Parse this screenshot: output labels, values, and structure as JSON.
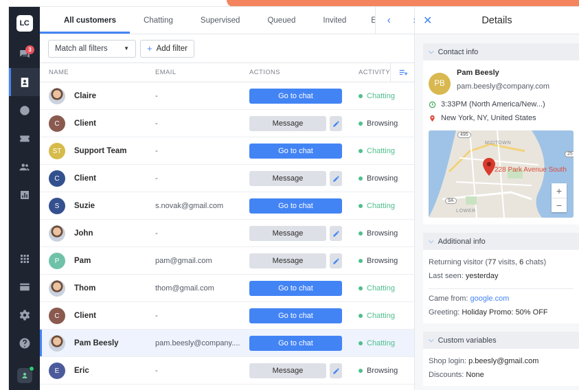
{
  "sidebar": {
    "logo_text": "LC",
    "chats_badge": "3",
    "items": [
      {
        "icon": "chat-bubbles-icon"
      },
      {
        "icon": "customers-icon"
      },
      {
        "icon": "clock-icon"
      },
      {
        "icon": "inbox-icon"
      },
      {
        "icon": "team-icon"
      },
      {
        "icon": "reports-icon"
      },
      {
        "icon": "apps-grid-icon"
      },
      {
        "icon": "billing-card-icon"
      },
      {
        "icon": "settings-gear-icon"
      },
      {
        "icon": "help-icon"
      }
    ]
  },
  "tabs": {
    "items": [
      "All customers",
      "Chatting",
      "Supervised",
      "Queued",
      "Invited"
    ],
    "overflow": "E",
    "active": "All customers"
  },
  "filters": {
    "select_label": "Match all filters",
    "add_label": "Add filter"
  },
  "table": {
    "headers": {
      "name": "NAME",
      "email": "EMAIL",
      "actions": "ACTIONS",
      "activity": "ACTIVITY"
    },
    "rows": [
      {
        "initial": "",
        "photo": true,
        "avatar_color": "",
        "name": "Claire",
        "email": "-",
        "action": "Go to chat",
        "action_type": "chat",
        "status": "Chatting"
      },
      {
        "initial": "C",
        "photo": false,
        "avatar_color": "#8a5a4f",
        "name": "Client",
        "email": "-",
        "action": "Message",
        "action_type": "msg",
        "status": "Browsing"
      },
      {
        "initial": "ST",
        "photo": false,
        "avatar_color": "#d6bb4b",
        "name": "Support Team",
        "email": "-",
        "action": "Go to chat",
        "action_type": "chat",
        "status": "Chatting"
      },
      {
        "initial": "C",
        "photo": false,
        "avatar_color": "#33508f",
        "name": "Client",
        "email": "-",
        "action": "Message",
        "action_type": "msg",
        "status": "Browsing"
      },
      {
        "initial": "S",
        "photo": false,
        "avatar_color": "#34508f",
        "name": "Suzie",
        "email": "s.novak@gmail.com",
        "action": "Go to chat",
        "action_type": "chat",
        "status": "Chatting"
      },
      {
        "initial": "",
        "photo": true,
        "avatar_color": "",
        "name": "John",
        "email": "-",
        "action": "Message",
        "action_type": "msg",
        "status": "Browsing"
      },
      {
        "initial": "P",
        "photo": false,
        "avatar_color": "#6fc2a8",
        "name": "Pam",
        "email": "pam@gmail.com",
        "action": "Message",
        "action_type": "msg",
        "status": "Browsing"
      },
      {
        "initial": "",
        "photo": true,
        "avatar_color": "",
        "name": "Thom",
        "email": "thom@gmail.com",
        "action": "Go to chat",
        "action_type": "chat",
        "status": "Chatting"
      },
      {
        "initial": "C",
        "photo": false,
        "avatar_color": "#8a5a4f",
        "name": "Client",
        "email": "-",
        "action": "Go to chat",
        "action_type": "chat",
        "status": "Chatting"
      },
      {
        "initial": "",
        "photo": true,
        "avatar_color": "",
        "name": "Pam Beesly",
        "email": "pam.beesly@company....",
        "action": "Go to chat",
        "action_type": "chat",
        "status": "Chatting",
        "selected": true
      },
      {
        "initial": "E",
        "photo": false,
        "avatar_color": "#4a5a9a",
        "name": "Eric",
        "email": "-",
        "action": "Message",
        "action_type": "msg",
        "status": "Browsing"
      }
    ]
  },
  "colors": {
    "accent": "#4384f5",
    "chatting": "#4fbf8c",
    "browsing": "#4fbf8c",
    "sidebar_bg": "#1e2531",
    "brand_orange": "#f3845d"
  },
  "details": {
    "title": "Details",
    "contact": {
      "section_label": "Contact info",
      "initials": "PB",
      "name": "Pam Beesly",
      "email": "pam.beesly@company.com",
      "local_time": "3:33PM (North America/New...)",
      "location": "New York, NY, United States",
      "map_address": "228 Park Avenue South",
      "map_area_midtown": "MIDTOWN",
      "map_area_lower": "LOWER",
      "map_route_1": "495",
      "map_route_2": "9A",
      "map_route_3": "25",
      "map_zoom_in": "+",
      "map_zoom_out": "−"
    },
    "additional": {
      "section_label": "Additional info",
      "returning_prefix": "Returning visitor (",
      "visits": "77",
      "visits_label": " visits, ",
      "chats": "6",
      "chats_label": " chats)",
      "last_seen_label": "Last seen: ",
      "last_seen": "yesterday",
      "came_from_label": "Came from: ",
      "came_from": "google.com",
      "greeting_label": "Greeting: ",
      "greeting": "Holiday Promo: 50% OFF"
    },
    "custom": {
      "section_label": "Custom variables",
      "shop_login_label": "Shop login: ",
      "shop_login": "p.beesly@gmail.com",
      "discounts_label": "Discounts: ",
      "discounts": "None"
    }
  }
}
